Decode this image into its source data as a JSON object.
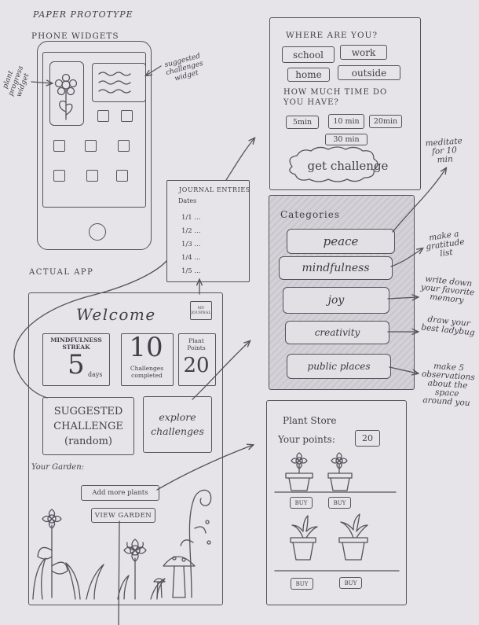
{
  "header": {
    "title": "PAPER PROTOTYPE",
    "widgets_label": "PHONE WIDGETS",
    "actual_app_label": "ACTUAL APP"
  },
  "phone_notes": {
    "plant_progress": "plant progress widget",
    "suggested_challenges": "suggested challenges widget"
  },
  "where_screen": {
    "question": "WHERE ARE YOU?",
    "locations": [
      "school",
      "work",
      "home",
      "outside"
    ],
    "time_question": "HOW MUCH TIME DO YOU HAVE?",
    "times": [
      "5min",
      "10 min",
      "20min",
      "30 min"
    ],
    "cta": "get challenge"
  },
  "journal": {
    "title": "JOURNAL ENTRIES",
    "subtitle": "Dates",
    "entries": [
      "1/1",
      "1/2",
      "1/3",
      "1/4",
      "1/5"
    ]
  },
  "home_screen": {
    "welcome": "Welcome",
    "journal_icon_label": "MY JOURNAL",
    "streak_label": "MINDFULNESS STREAK",
    "streak_value": "5",
    "streak_unit": "days",
    "challenges_value": "10",
    "challenges_label": "Challenges completed",
    "points_label": "Plant Points",
    "points_value": "20",
    "suggested": "SUGGESTED CHALLENGE (random)",
    "explore": "explore challenges",
    "garden_label": "Your Garden:",
    "add_plants": "Add more plants",
    "view_garden": "VIEW GARDEN"
  },
  "categories": {
    "title": "Categories",
    "items": [
      "peace",
      "mindfulness",
      "joy",
      "creativity",
      "public places"
    ]
  },
  "category_notes": {
    "peace": "meditate for 10 min",
    "mindfulness": "make a gratitude list",
    "joy": "write down your favorite memory",
    "creativity": "draw your best ladybug",
    "public_places": "make 5 observations about the space around you"
  },
  "store": {
    "title": "Plant Store",
    "points_label": "Your points:",
    "points_value": "20",
    "buy_label": "BUY"
  }
}
